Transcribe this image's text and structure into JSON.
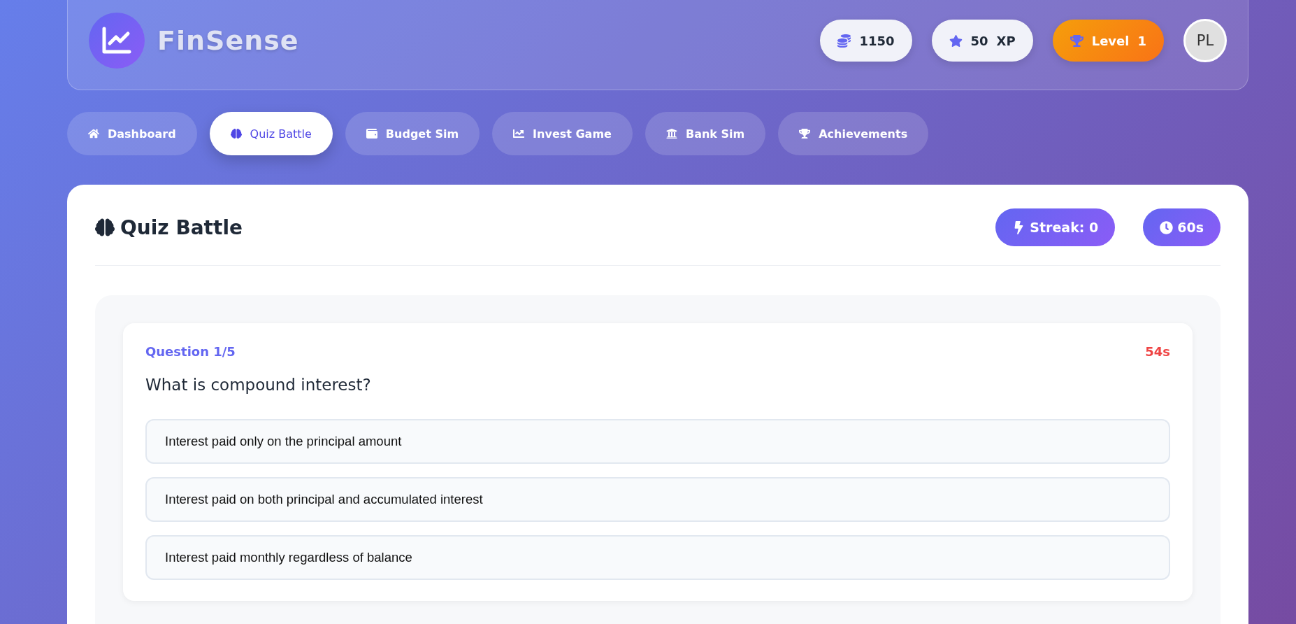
{
  "app": {
    "name": "FinSense"
  },
  "stats": [
    {
      "kind": "coins",
      "value": "1150"
    },
    {
      "kind": "xp",
      "value": "50",
      "unit": "XP"
    },
    {
      "kind": "level",
      "label": "Level",
      "value": "1"
    }
  ],
  "avatar": {
    "initials": "PL"
  },
  "tabs": [
    {
      "label": "Dashboard",
      "selected": false
    },
    {
      "label": "Quiz Battle",
      "selected": true
    },
    {
      "label": "Budget Sim",
      "selected": false
    },
    {
      "label": "Invest Game",
      "selected": false
    },
    {
      "label": "Bank Sim",
      "selected": false
    },
    {
      "label": "Achievements",
      "selected": false
    }
  ],
  "quiz": {
    "title": "Quiz Battle",
    "streak": "Streak: 0",
    "timer": "60s",
    "question_number": "Question 1/5",
    "time_left": "54s",
    "question": "What is compound interest?",
    "options": [
      {
        "text": "Interest paid only on the principal amount"
      },
      {
        "text": "Interest paid on both principal and accumulated interest"
      },
      {
        "text": "Interest paid monthly regardless of balance"
      }
    ]
  }
}
